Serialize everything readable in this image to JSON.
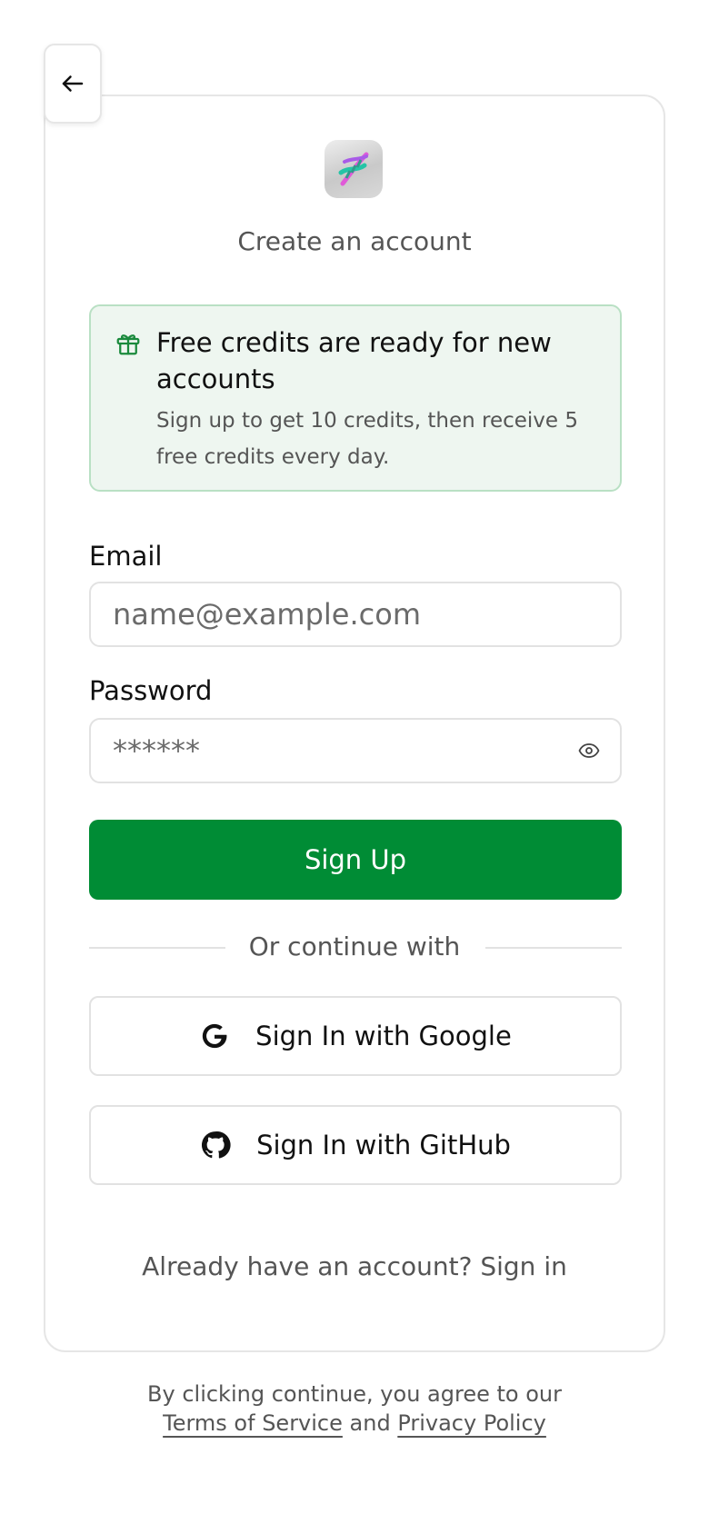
{
  "header": {
    "back_icon": "arrow-left-icon"
  },
  "card": {
    "logo_icon": "dna-icon",
    "title": "Create an account"
  },
  "promo": {
    "icon": "gift-icon",
    "title": "Free credits are ready for new accounts",
    "text": "Sign up to get 10 credits, then receive 5 free credits every day.",
    "accent_color": "#1a8a3c",
    "background_color": "#eef6f0",
    "border_color": "#b9e0c4"
  },
  "form": {
    "email_label": "Email",
    "email_placeholder": "name@example.com",
    "email_value": "",
    "password_label": "Password",
    "password_placeholder": "******",
    "password_value": "",
    "password_toggle_icon": "eye-icon",
    "submit_label": "Sign Up",
    "primary_color": "#008c35"
  },
  "divider": {
    "text": "Or continue with"
  },
  "social": {
    "google_label": "Sign In with Google",
    "google_icon": "google-icon",
    "github_label": "Sign In with GitHub",
    "github_icon": "github-icon"
  },
  "footer": {
    "already_text": "Already have an account? ",
    "signin_link": "Sign in",
    "legal_prefix": "By clicking continue, you agree to our",
    "terms_link": "Terms of Service",
    "legal_and": " and ",
    "privacy_link": "Privacy Policy"
  }
}
